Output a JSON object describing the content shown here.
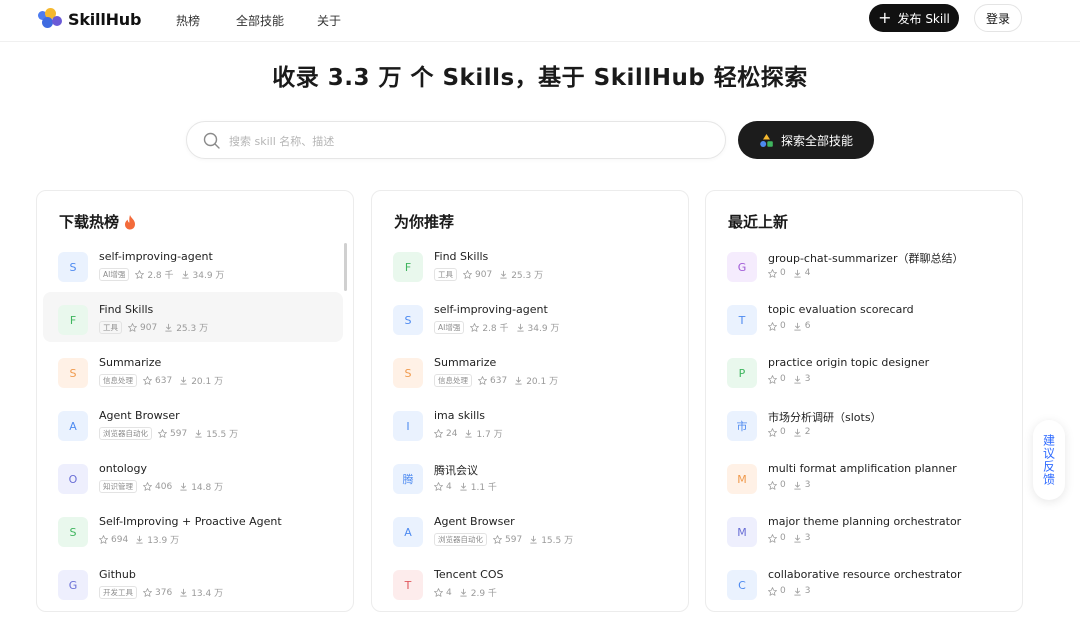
{
  "brand": {
    "name": "SkillHub"
  },
  "nav": {
    "hot": "热榜",
    "all": "全部技能",
    "about": "关于"
  },
  "header": {
    "publish_label": "发布 Skill",
    "login_label": "登录"
  },
  "hero": {
    "title": "收录 3.3 万 个 Skills，基于 SkillHub 轻松探索",
    "search_placeholder": "搜索 skill 名称、描述",
    "explore_label": "探索全部技能"
  },
  "columns": [
    {
      "title": "下载热榜",
      "items": [
        {
          "letter": "S",
          "name": "self-improving-agent",
          "tag": "AI增强",
          "stars": "2.8 千",
          "downloads": "34.9 万",
          "color": "#4d8af0",
          "bg": "#eaf2fe"
        },
        {
          "letter": "F",
          "name": "Find Skills",
          "tag": "工具",
          "stars": "907",
          "downloads": "25.3 万",
          "color": "#3fb55e",
          "bg": "#e9f8ed"
        },
        {
          "letter": "S",
          "name": "Summarize",
          "tag": "信息处理",
          "stars": "637",
          "downloads": "20.1 万",
          "color": "#f09a4d",
          "bg": "#fff1e6"
        },
        {
          "letter": "A",
          "name": "Agent Browser",
          "tag": "浏览器自动化",
          "stars": "597",
          "downloads": "15.5 万",
          "color": "#4d8af0",
          "bg": "#eaf2fe"
        },
        {
          "letter": "O",
          "name": "ontology",
          "tag": "知识管理",
          "stars": "406",
          "downloads": "14.8 万",
          "color": "#6a6fd6",
          "bg": "#eeeffd"
        },
        {
          "letter": "S",
          "name": "Self-Improving + Proactive Agent",
          "tag": "",
          "stars": "694",
          "downloads": "13.9 万",
          "color": "#3fb55e",
          "bg": "#e9f8ed"
        },
        {
          "letter": "G",
          "name": "Github",
          "tag": "开发工具",
          "stars": "376",
          "downloads": "13.4 万",
          "color": "#6a6fd6",
          "bg": "#eeeffd"
        }
      ]
    },
    {
      "title": "为你推荐",
      "items": [
        {
          "letter": "F",
          "name": "Find Skills",
          "tag": "工具",
          "stars": "907",
          "downloads": "25.3 万",
          "color": "#3fb55e",
          "bg": "#e9f8ed"
        },
        {
          "letter": "S",
          "name": "self-improving-agent",
          "tag": "AI增强",
          "stars": "2.8 千",
          "downloads": "34.9 万",
          "color": "#4d8af0",
          "bg": "#eaf2fe"
        },
        {
          "letter": "S",
          "name": "Summarize",
          "tag": "信息处理",
          "stars": "637",
          "downloads": "20.1 万",
          "color": "#f09a4d",
          "bg": "#fff1e6"
        },
        {
          "letter": "I",
          "name": "ima skills",
          "tag": "",
          "stars": "24",
          "downloads": "1.7 万",
          "color": "#4d8af0",
          "bg": "#eaf2fe"
        },
        {
          "letter": "腾",
          "name": "腾讯会议",
          "tag": "",
          "stars": "4",
          "downloads": "1.1 千",
          "color": "#4d8af0",
          "bg": "#eaf2fe"
        },
        {
          "letter": "A",
          "name": "Agent Browser",
          "tag": "浏览器自动化",
          "stars": "597",
          "downloads": "15.5 万",
          "color": "#4d8af0",
          "bg": "#eaf2fe"
        },
        {
          "letter": "T",
          "name": "Tencent COS",
          "tag": "",
          "stars": "4",
          "downloads": "2.9 千",
          "color": "#e0565c",
          "bg": "#fdecec"
        }
      ]
    },
    {
      "title": "最近上新",
      "items": [
        {
          "letter": "G",
          "name": "group-chat-summarizer（群聊总结）",
          "tag": "",
          "stars": "0",
          "downloads": "4",
          "color": "#a05ad6",
          "bg": "#f5ecfd"
        },
        {
          "letter": "T",
          "name": "topic evaluation scorecard",
          "tag": "",
          "stars": "0",
          "downloads": "6",
          "color": "#4d8af0",
          "bg": "#eaf2fe"
        },
        {
          "letter": "P",
          "name": "practice origin topic designer",
          "tag": "",
          "stars": "0",
          "downloads": "3",
          "color": "#3fb55e",
          "bg": "#e9f8ed"
        },
        {
          "letter": "市",
          "name": "市场分析调研（slots）",
          "tag": "",
          "stars": "0",
          "downloads": "2",
          "color": "#4d8af0",
          "bg": "#eaf2fe"
        },
        {
          "letter": "M",
          "name": "multi format amplification planner",
          "tag": "",
          "stars": "0",
          "downloads": "3",
          "color": "#f09a4d",
          "bg": "#fff1e6"
        },
        {
          "letter": "M",
          "name": "major theme planning orchestrator",
          "tag": "",
          "stars": "0",
          "downloads": "3",
          "color": "#6a6fd6",
          "bg": "#eeeffd"
        },
        {
          "letter": "C",
          "name": "collaborative resource orchestrator",
          "tag": "",
          "stars": "0",
          "downloads": "3",
          "color": "#4d8af0",
          "bg": "#eaf2fe"
        }
      ]
    }
  ],
  "feedback": {
    "label": "建议反馈"
  }
}
